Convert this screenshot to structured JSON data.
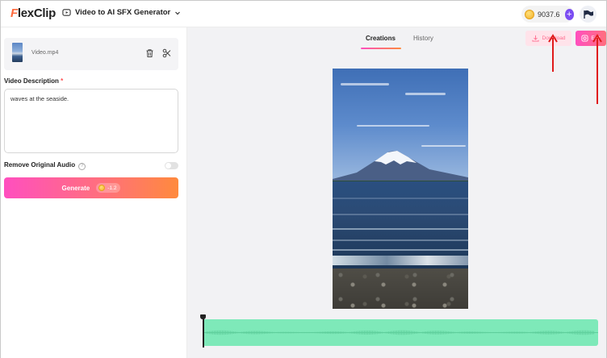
{
  "app": {
    "logo_text": "lexClip",
    "logo_initial": "F"
  },
  "header": {
    "tool_name": "Video to AI SFX Generator",
    "credits": "9037.6",
    "plus_label": "+"
  },
  "file": {
    "name": "Video.mp4"
  },
  "description": {
    "label": "Video Description",
    "required_mark": "*",
    "value": "waves at the seaside."
  },
  "remove_audio": {
    "label": "Remove Original Audio",
    "help": "?",
    "enabled": false
  },
  "generate": {
    "label": "Generate",
    "cost": "-1.2"
  },
  "tabs": [
    {
      "label": "Creations",
      "active": true
    },
    {
      "label": "History",
      "active": false
    }
  ],
  "actions": {
    "download_label": "Download",
    "edit_label": "Edit"
  },
  "colors": {
    "accent_gradient_start": "#ff4fbf",
    "accent_gradient_end": "#ff8a3d",
    "waveform": "#7ee9b9",
    "annotation_arrow": "#e01b1b"
  }
}
